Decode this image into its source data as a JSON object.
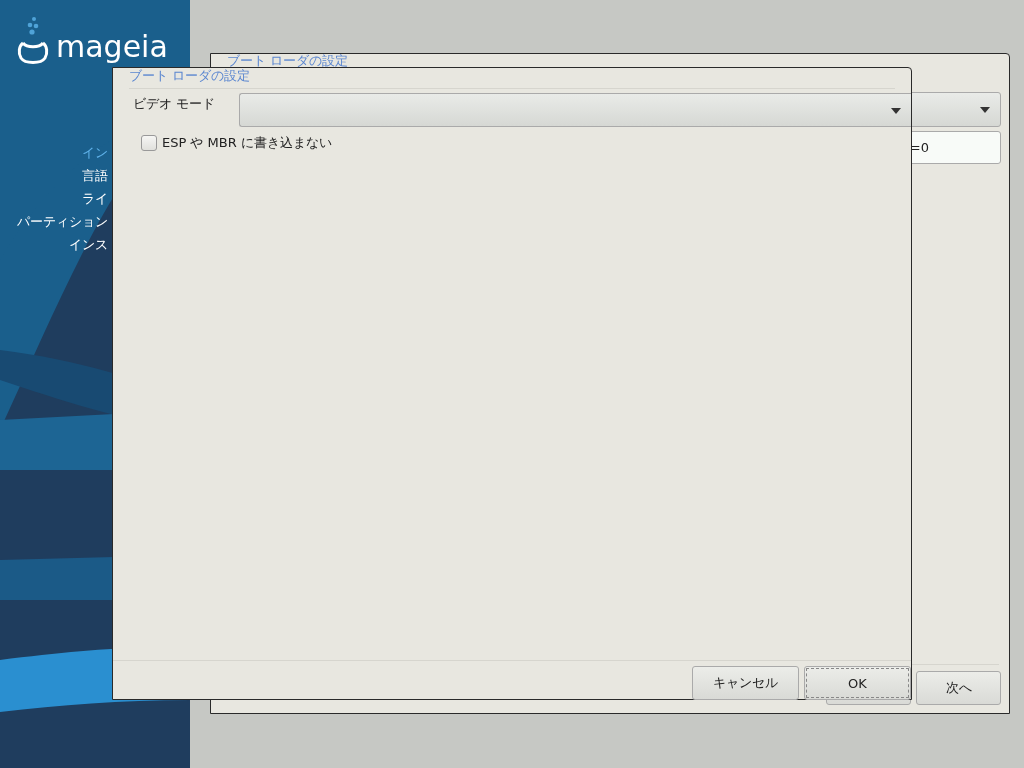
{
  "sidebar": {
    "logo": "mageia",
    "steps": [
      {
        "label": "イン",
        "selected": true
      },
      {
        "label": "言語",
        "selected": false
      },
      {
        "label": "ライ",
        "selected": false
      },
      {
        "label": "パーティション",
        "selected": false
      },
      {
        "label": "インス",
        "selected": false
      }
    ]
  },
  "back_window": {
    "title": "ブート ローダの設定",
    "field_value": "=0",
    "next_button": "次へ"
  },
  "dialog": {
    "title": "ブート ローダの設定",
    "video_mode_label": "ビデオ モード",
    "checkbox": {
      "label": "ESP や MBR に書き込まない",
      "checked": false
    },
    "buttons": [
      {
        "label": "キャンセル",
        "focused": false
      },
      {
        "label": "OK",
        "focused": true
      }
    ]
  }
}
